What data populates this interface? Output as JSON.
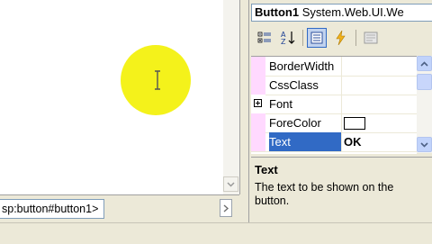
{
  "editor": {
    "tag_breadcrumb": "sp:button#button1>"
  },
  "properties": {
    "object_name": "Button1",
    "object_type": "System.Web.UI.We",
    "toolbar": [
      {
        "icon": "categorized-icon"
      },
      {
        "icon": "alphabetical-icon"
      },
      {
        "icon": "properties-icon",
        "pressed": true
      },
      {
        "icon": "events-icon"
      },
      {
        "icon": "property-pages-icon"
      }
    ],
    "rows": [
      {
        "name": "BorderWidth",
        "value": ""
      },
      {
        "name": "CssClass",
        "value": ""
      },
      {
        "name": "Font",
        "value": "",
        "expandable": true
      },
      {
        "name": "ForeColor",
        "value": "",
        "color": "#ffffff"
      },
      {
        "name": "Text",
        "value": "OK",
        "selected": true
      }
    ],
    "description": {
      "title": "Text",
      "text": "The text to be shown on the button."
    }
  },
  "colors": {
    "highlight": "#f4f21b",
    "selection": "#316ac5",
    "gutter": "#ffd9ff"
  }
}
